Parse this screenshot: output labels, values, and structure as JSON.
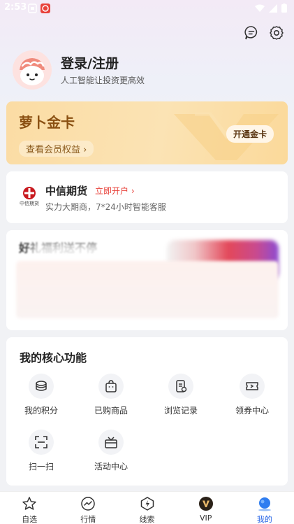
{
  "status_bar": {
    "time": "2:53"
  },
  "header": {
    "login_title": "登录/注册",
    "login_subtitle": "人工智能让投资更高效"
  },
  "gold_card": {
    "title": "萝卜金卡",
    "benefits_link": "查看会员权益 ›",
    "open_button": "开通金卡"
  },
  "citic": {
    "name": "中信期货",
    "open_link": "立即开户 ›",
    "description": "实力大期商，7*24小时智能客服",
    "logo_text": "中信期货"
  },
  "promo": {
    "title": "好礼福利送不停"
  },
  "features": {
    "title": "我的核心功能",
    "items": [
      {
        "label": "我的积分",
        "icon": "coins-icon"
      },
      {
        "label": "已购商品",
        "icon": "shopping-bag-icon"
      },
      {
        "label": "浏览记录",
        "icon": "history-document-icon"
      },
      {
        "label": "领券中心",
        "icon": "coupon-icon"
      },
      {
        "label": "扫一扫",
        "icon": "scan-icon"
      },
      {
        "label": "活动中心",
        "icon": "gift-box-icon"
      }
    ]
  },
  "tabbar": {
    "tabs": [
      {
        "label": "自选",
        "icon": "star-icon",
        "active": false
      },
      {
        "label": "行情",
        "icon": "market-trend-icon",
        "active": false
      },
      {
        "label": "线索",
        "icon": "lightning-icon",
        "active": false
      },
      {
        "label": "VIP",
        "icon": "vip-icon",
        "active": false
      },
      {
        "label": "我的",
        "icon": "profile-icon",
        "active": true
      }
    ]
  },
  "colors": {
    "accent": "#2060e6",
    "gold_text": "#8a5012",
    "citic_red": "#e8413a"
  }
}
